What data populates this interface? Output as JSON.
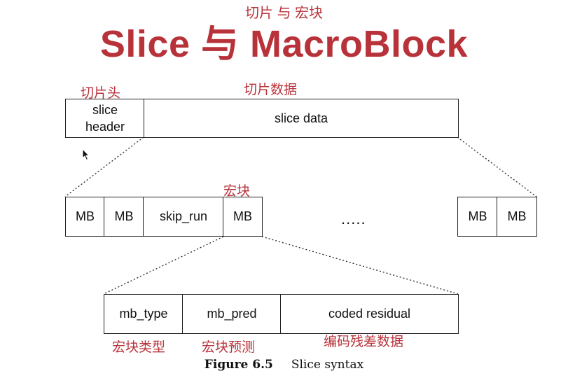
{
  "title": {
    "subtitle": "切片 与 宏块",
    "main": "Slice 与 MacroBlock"
  },
  "slice": {
    "header_label_cn": "切片头",
    "data_label_cn": "切片数据",
    "header_text": "slice\nheader",
    "data_text": "slice data"
  },
  "mb_row": {
    "macroblock_label_cn": "宏块",
    "cells": [
      "MB",
      "MB",
      "skip_run",
      "MB"
    ],
    "ellipsis": ".....",
    "tail_cells": [
      "MB",
      "MB"
    ]
  },
  "mb_detail": {
    "cells": [
      "mb_type",
      "mb_pred",
      "coded residual"
    ],
    "labels_cn": [
      "宏块类型",
      "宏块预测",
      "编码残差数据"
    ]
  },
  "caption": {
    "figure": "Figure 6.5",
    "text": "Slice syntax"
  },
  "colors": {
    "accent": "#b8323a",
    "line": "#222222"
  }
}
